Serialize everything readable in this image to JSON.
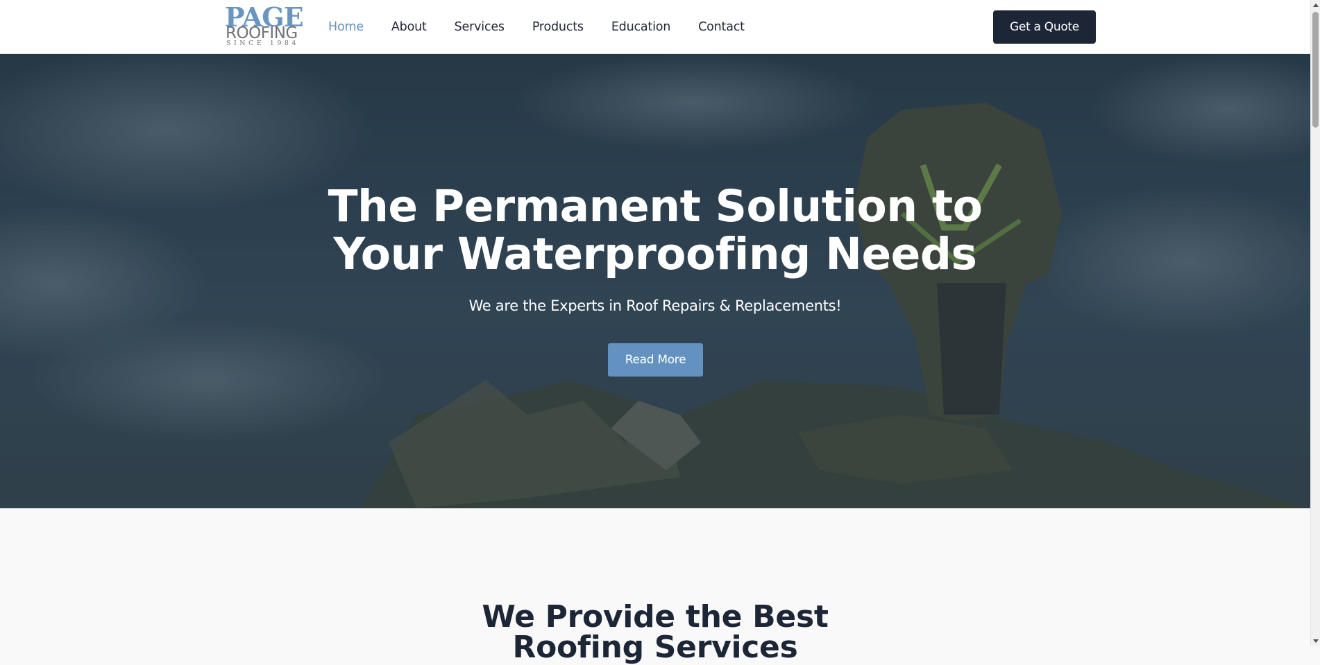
{
  "brand": {
    "logo_line1": "PAGE",
    "logo_line2": "ROOFING",
    "logo_line3": "SINCE 1984",
    "colors": {
      "blue": "#6391c0",
      "navy": "#1d2636",
      "gray": "#6e7276"
    }
  },
  "nav": {
    "items": [
      {
        "label": "Home",
        "active": true
      },
      {
        "label": "About",
        "active": false
      },
      {
        "label": "Services",
        "active": false
      },
      {
        "label": "Products",
        "active": false
      },
      {
        "label": "Education",
        "active": false
      },
      {
        "label": "Contact",
        "active": false
      }
    ],
    "quote_label": "Get a Quote"
  },
  "hero": {
    "title_line1": "The Permanent Solution to",
    "title_line2": "Your Waterproofing Needs",
    "subtitle": "We are the Experts in Roof Repairs & Replacements!",
    "cta_label": "Read More"
  },
  "services": {
    "heading_line1": "We Provide the Best",
    "heading_line2": "Roofing Services"
  }
}
